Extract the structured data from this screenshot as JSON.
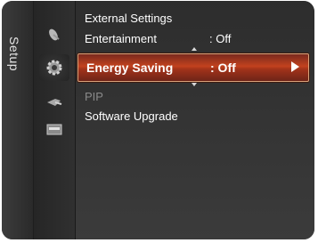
{
  "sidebar": {
    "tab_label": "Setup",
    "icons": [
      "satellite-dish-icon",
      "gear-icon",
      "input-plug-icon",
      "support-card-icon"
    ]
  },
  "menu": {
    "items": [
      {
        "label": "External Settings",
        "value": "",
        "state": "normal"
      },
      {
        "label": "Entertainment",
        "value": ": Off",
        "state": "normal"
      },
      {
        "label": "Energy Saving",
        "value": ": Off",
        "state": "selected"
      },
      {
        "label": "PIP",
        "value": "",
        "state": "disabled"
      },
      {
        "label": "Software Upgrade",
        "value": "",
        "state": "normal"
      }
    ]
  },
  "colors": {
    "highlight": "#c2421e",
    "background": "#2d2d2d",
    "text": "#ffffff",
    "disabled_text": "#8a8a8a"
  }
}
